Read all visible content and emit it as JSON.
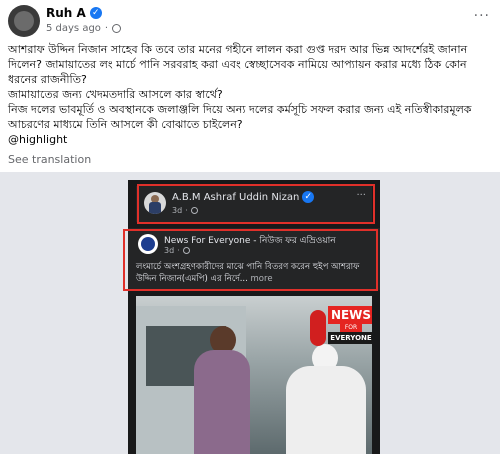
{
  "post": {
    "author": "Ruh A",
    "time": "5 days ago",
    "paragraphs": [
      "আশরাফ উদ্দিন নিজান সাহেব কি তবে তার মনের গহীনে লালন করা গুপ্ত দরদ আর ভিন্ন আদর্শেরই জানান দিলেন? জামায়াতের লং মার্চে পানি সরবরাহ করা এবং স্বেচ্ছাসেবক নামিয়ে আপ্যায়ন করার মধ্যে ঠিক কোন ধরনের রাজনীতি?",
      "জামায়াতের জন্য খেদমতদারি আসলে কার স্বার্থে?",
      "নিজ দলের ভাবমূর্তি ও অবস্থানকে জলাঞ্জলি দিয়ে অন্য দলের কর্মসূচি সফল করার জন্য এই নতিস্বীকারমূলক আচরণের মাধ্যমে তিনি আসলে কী বোঝাতে চাইলেন?",
      "@highlight"
    ],
    "see_translation": "See translation"
  },
  "embedded": {
    "card1": {
      "name": "A.B.M Ashraf Uddin Nizan",
      "time": "3d"
    },
    "card2": {
      "title": "News For Everyone - নিউজ ফর এভ্রিওয়ান",
      "time": "3d",
      "text": "লংমার্চে অংশগ্রহণকারীদের মাঝে পানি বিতরণ করেন হুইপ আশরাফ উদ্দিন নিজান(এমপি) এর নির্দে...",
      "more": "more"
    },
    "news_logo": {
      "line1": "NEWS",
      "line2": "FOR",
      "line3": "EVERYONE"
    }
  },
  "colors": {
    "highlight_box": "#e0302a",
    "verified": "#1877f2"
  }
}
